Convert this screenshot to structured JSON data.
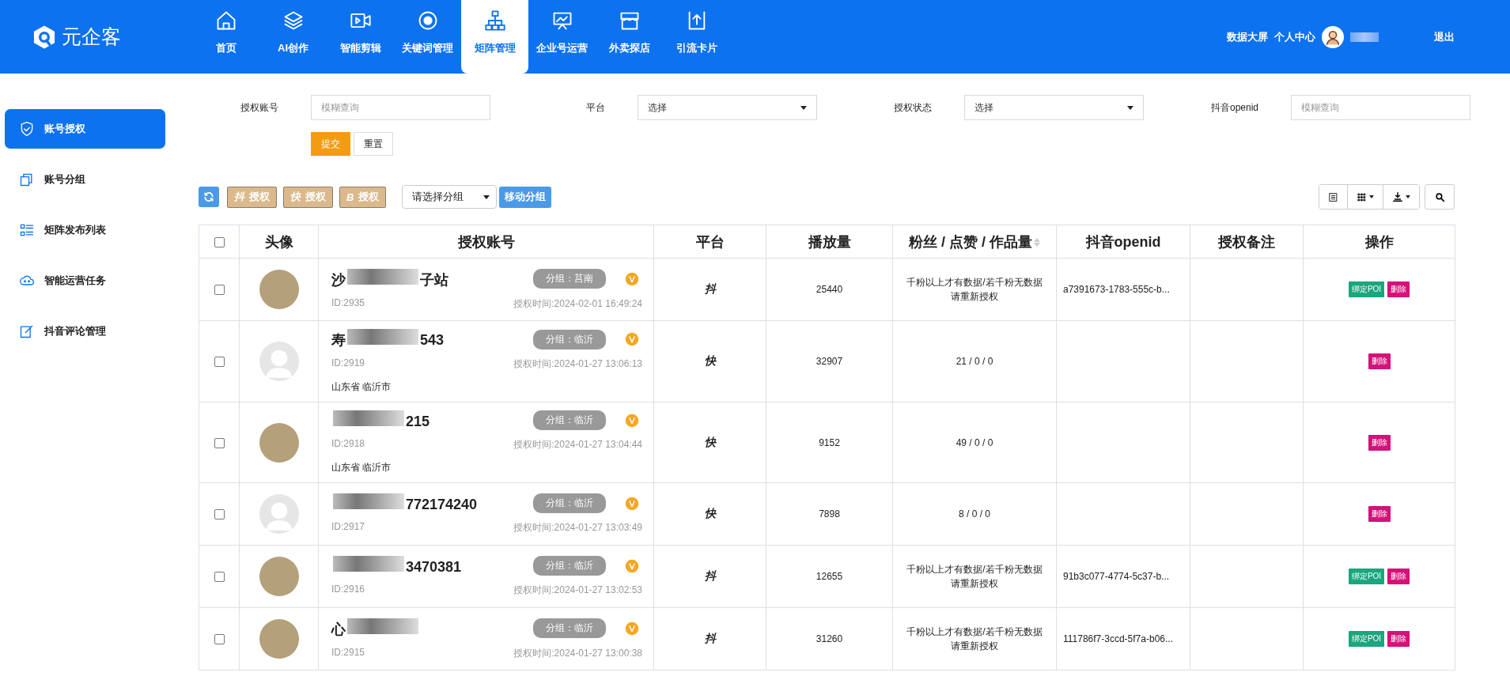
{
  "header": {
    "logo_text": "元企客",
    "nav": [
      {
        "label": "首页",
        "selected": false
      },
      {
        "label": "AI创作",
        "selected": false
      },
      {
        "label": "智能剪辑",
        "selected": false
      },
      {
        "label": "关键词管理",
        "selected": false
      },
      {
        "label": "矩阵管理",
        "selected": true
      },
      {
        "label": "企业号运营",
        "selected": false
      },
      {
        "label": "外卖探店",
        "selected": false
      },
      {
        "label": "引流卡片",
        "selected": false
      }
    ],
    "links": [
      "数据大屏",
      "个人中心"
    ],
    "user_redacted": true,
    "logout": "退出"
  },
  "sidebar": {
    "items": [
      {
        "label": "账号授权",
        "selected": true
      },
      {
        "label": "账号分组",
        "selected": false
      },
      {
        "label": "矩阵发布列表",
        "selected": false
      },
      {
        "label": "智能运营任务",
        "selected": false
      },
      {
        "label": "抖音评论管理",
        "selected": false
      }
    ]
  },
  "filters": [
    {
      "label": "授权账号",
      "kind": "input",
      "placeholder": "模糊查询"
    },
    {
      "label": "平台",
      "kind": "select",
      "value": "选择"
    },
    {
      "label": "授权状态",
      "kind": "select",
      "value": "选择"
    },
    {
      "label": "抖音openid",
      "kind": "input",
      "placeholder": "模糊查询"
    }
  ],
  "filter_buttons": [
    {
      "label": "提交",
      "kind": "primary"
    },
    {
      "label": "重置",
      "kind": "plain"
    }
  ],
  "toolbar": {
    "auth_buttons": [
      {
        "mark": "抖",
        "label": "授权"
      },
      {
        "mark": "快",
        "label": "授权"
      },
      {
        "mark": "B",
        "label": "授权"
      }
    ],
    "group_select": "请选择分组",
    "move_button": "移动分组"
  },
  "table": {
    "select_all": {
      "checked": false
    },
    "columns": [
      {
        "label": "头像"
      },
      {
        "label": "授权账号"
      },
      {
        "label": "平台"
      },
      {
        "label": "播放量"
      },
      {
        "label": "粉丝 / 点赞 / 作品量",
        "sortable": true
      },
      {
        "label": "抖音openid"
      },
      {
        "label": "授权备注"
      },
      {
        "label": "操作"
      }
    ],
    "rows": [
      {
        "checked": false,
        "kind": "photo",
        "name_prefix": "沙",
        "redacted": true,
        "name_suffix": "子站",
        "group": "分组：莒南",
        "id": "ID:2935",
        "time": "授权时间:2024-02-01 16:49:24",
        "region": "",
        "platform": "抖",
        "plays": "25440",
        "stats": "千粉以上才有数据/若千粉无数据请重新授权",
        "openid": "a7391673-1783-555c-b...",
        "actions": [
          {
            "label": "绑定POI",
            "kind": "bind"
          },
          {
            "label": "删除",
            "kind": "delete"
          }
        ]
      },
      {
        "checked": false,
        "kind": "default",
        "name_prefix": "寿",
        "redacted": true,
        "name_suffix": "543",
        "group": "分组：临沂",
        "id": "ID:2919",
        "time": "授权时间:2024-01-27 13:06:13",
        "region": "山东省 临沂市",
        "platform": "快",
        "plays": "32907",
        "stats": "21 / 0 / 0",
        "openid": "",
        "actions": [
          {
            "label": "删除",
            "kind": "delete"
          }
        ]
      },
      {
        "checked": false,
        "kind": "photo",
        "name_prefix": "",
        "redacted": true,
        "name_suffix": "215",
        "group": "分组：临沂",
        "id": "ID:2918",
        "time": "授权时间:2024-01-27 13:04:44",
        "region": "山东省 临沂市",
        "platform": "快",
        "plays": "9152",
        "stats": "49 / 0 / 0",
        "openid": "",
        "actions": [
          {
            "label": "删除",
            "kind": "delete"
          }
        ]
      },
      {
        "checked": false,
        "kind": "default",
        "name_prefix": "",
        "redacted": true,
        "name_suffix": "772174240",
        "group": "分组：临沂",
        "id": "ID:2917",
        "time": "授权时间:2024-01-27 13:03:49",
        "region": "",
        "platform": "快",
        "plays": "7898",
        "stats": "8 / 0 / 0",
        "openid": "",
        "actions": [
          {
            "label": "删除",
            "kind": "delete"
          }
        ]
      },
      {
        "checked": false,
        "kind": "photo",
        "name_prefix": "",
        "redacted": true,
        "name_suffix": "3470381",
        "group": "分组：临沂",
        "id": "ID:2916",
        "time": "授权时间:2024-01-27 13:02:53",
        "region": "",
        "platform": "抖",
        "plays": "12655",
        "stats": "千粉以上才有数据/若千粉无数据请重新授权",
        "openid": "91b3c077-4774-5c37-b...",
        "actions": [
          {
            "label": "绑定POI",
            "kind": "bind"
          },
          {
            "label": "删除",
            "kind": "delete"
          }
        ]
      },
      {
        "checked": false,
        "kind": "photo",
        "name_prefix": "心",
        "redacted": true,
        "name_suffix": "",
        "group": "分组：临沂",
        "id": "ID:2915",
        "time": "授权时间:2024-01-27 13:00:38",
        "region": "",
        "platform": "抖",
        "plays": "31260",
        "stats": "千粉以上才有数据/若千粉无数据请重新授权",
        "openid": "111786f7-3ccd-5f7a-b06...",
        "actions": [
          {
            "label": "绑定POI",
            "kind": "bind"
          },
          {
            "label": "删除",
            "kind": "delete"
          }
        ]
      }
    ]
  }
}
